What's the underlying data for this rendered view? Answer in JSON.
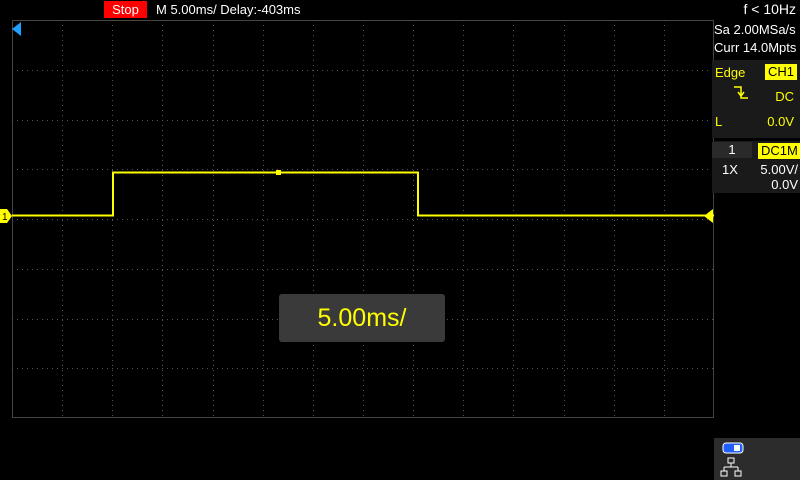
{
  "topbar": {
    "run_state": "Stop",
    "timebase_delay": "M 5.00ms/ Delay:-403ms",
    "frequency": "f < 10Hz"
  },
  "acquisition": {
    "sample_rate": "Sa 2.00MSa/s",
    "memory_depth": "Curr 14.0Mpts"
  },
  "trigger": {
    "type": "Edge",
    "source": "CH1",
    "slope_icon": "falling-edge-icon",
    "coupling": "DC",
    "level_label": "L",
    "level_value": "0.0V"
  },
  "channel1": {
    "number": "1",
    "coupling_impedance": "DC1M",
    "probe": "1X",
    "scale": "5.00V/",
    "offset": "0.0V",
    "marker_label": "1",
    "color": "#ffff00"
  },
  "popup": {
    "timebase": "5.00ms/"
  },
  "colors": {
    "trace": "#ffff00",
    "stop": "#ff0000",
    "trigger_position": "#1ea0ff"
  },
  "status_icons": [
    "usb-icon",
    "network-icon"
  ]
}
